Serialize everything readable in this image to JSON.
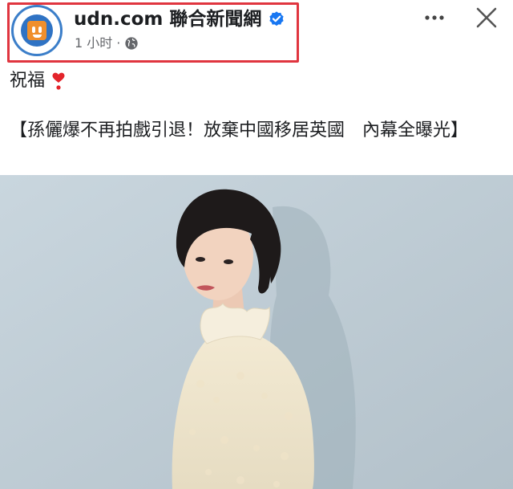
{
  "post": {
    "page_name": "udn.com 聯合新聞網",
    "timestamp": "1 小时",
    "separator": "·",
    "message_line": "祝福",
    "headline": "【孫儷爆不再拍戲引退！放棄中國移居英國　內幕全曝光】"
  },
  "icons": {
    "avatar": "udn-logo-icon",
    "verified": "verified-badge-icon",
    "privacy": "globe-icon",
    "more": "more-options-icon",
    "close": "close-icon",
    "emoji": "red-heart-exclamation-icon"
  },
  "colors": {
    "highlight": "#e0353f",
    "verified": "#1877f2",
    "meta_text": "#65676b",
    "photo_background": "#c7d3da"
  }
}
